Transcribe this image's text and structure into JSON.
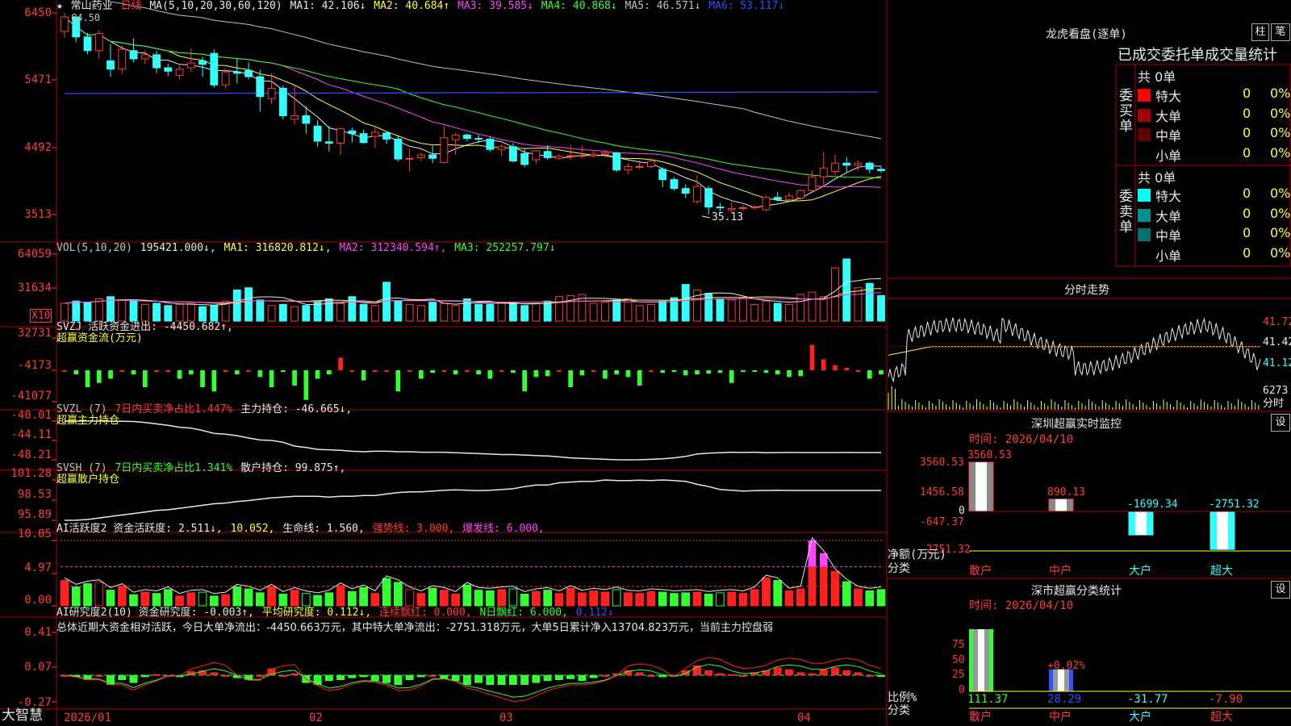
{
  "main": {
    "star": "★",
    "stock_name": "常山药业",
    "period": "日线",
    "ma_spec": "MA(5,10,20,30,60,120)",
    "ma": [
      {
        "label": "MA1:",
        "value": "42.106",
        "arrow": "↓",
        "color": "#e8e8e8"
      },
      {
        "label": "MA2:",
        "value": "40.684",
        "arrow": "↑",
        "color": "#ffff33"
      },
      {
        "label": "MA3:",
        "value": "39.585",
        "arrow": "↓",
        "color": "#ff44ff"
      },
      {
        "label": "MA4:",
        "value": "40.868",
        "arrow": "↓",
        "color": "#33ff33"
      },
      {
        "label": "MA5:",
        "value": "46.571",
        "arrow": "↓",
        "color": "#c0c0c0"
      },
      {
        "label": "MA6:",
        "value": "53.117",
        "arrow": "↓",
        "color": "#3050ff"
      }
    ],
    "y_labels": [
      "6450",
      "5471",
      "4492",
      "3513"
    ],
    "high_marker": "64.50",
    "low_marker": "35.13"
  },
  "vol": {
    "header": [
      {
        "t": "VOL(5,10,20)",
        "c": "#c0c0c0"
      },
      {
        "t": " 195421.000↓,",
        "c": "#e8e8e8"
      },
      {
        "t": " MA1: 316820.812↓,",
        "c": "#ffff33"
      },
      {
        "t": " MA2: 312340.594↑,",
        "c": "#ff44ff"
      },
      {
        "t": " MA3: 252257.797↓",
        "c": "#33ff33"
      }
    ],
    "y_labels": [
      "64059",
      "31634"
    ],
    "unit": "X10"
  },
  "svzj": {
    "header": [
      {
        "t": "SVZJ  活跃资金进出: -4450.682↑,",
        "c": "#e8e8e8"
      }
    ],
    "sub": "超赢资金流(万元)",
    "y_labels": [
      "32731",
      "-4173",
      "-41077"
    ]
  },
  "svzl": {
    "header": [
      {
        "t": "SVZL (7) ",
        "c": "#c0c0c0"
      },
      {
        "t": "7日内买卖净占比1.447%",
        "c": "#ff3b3b"
      },
      {
        "t": " 主力持仓: -46.665↓,",
        "c": "#e8e8e8"
      }
    ],
    "sub": "超赢主力持仓",
    "y_labels": [
      "-40.01",
      "-44.11",
      "-48.21"
    ]
  },
  "svsh": {
    "header": [
      {
        "t": "SVSH (7) ",
        "c": "#c0c0c0"
      },
      {
        "t": "7日内买卖净占比1.341%",
        "c": "#33ff33"
      },
      {
        "t": " 散户持仓: 99.875↑,",
        "c": "#e8e8e8"
      }
    ],
    "sub": "超赢散户持仓",
    "y_labels": [
      "101.28",
      "98.53",
      "95.89"
    ]
  },
  "ai1": {
    "header": [
      {
        "t": "AI活跃度2 资金活跃度: 2.511↓,",
        "c": "#e8e8e8"
      },
      {
        "t": " 10.052,",
        "c": "#ffff33"
      },
      {
        "t": " 生命线: 1.560,",
        "c": "#e8e8e8"
      },
      {
        "t": " 强势线: 3.000,",
        "c": "#ff3b3b"
      },
      {
        "t": " 爆发线: 6.000,",
        "c": "#ff44ff"
      }
    ],
    "y_labels": [
      "10.05",
      "4.97",
      "0.00"
    ]
  },
  "ai2": {
    "header": [
      {
        "t": "AI研究度2(10) 资金研究度: -0.003↑,",
        "c": "#e8e8e8"
      },
      {
        "t": " 平均研究度: 0.112↓,",
        "c": "#ffff33"
      },
      {
        "t": " 连续飘红: 0.000,",
        "c": "#ff3b3b"
      },
      {
        "t": " N日飘红: 6.000,",
        "c": "#33ff33"
      },
      {
        "t": " 0.112↓",
        "c": "#3050ff"
      }
    ],
    "summary": "总体近期大资金相对活跃，今日大单净流出：-4450.663万元，其中特大单净流出：-2751.318万元，大单5日累计净入13704.823万元，当前主力控盘弱",
    "y_labels": [
      "0.41",
      "0.07",
      "-0.27"
    ]
  },
  "xaxis": {
    "brand": "大智慧",
    "dates": [
      "2026/01",
      "02",
      "03",
      "04"
    ]
  },
  "right": {
    "tiger_title": "龙虎看盘(逐单)",
    "btn_bar": "柱",
    "btn_pen": "笔",
    "tabs_text": "已成交委托单成交量统计",
    "buy_group_label": "委买单",
    "sell_group_label": "委卖单",
    "buy_total": "共 0单",
    "sell_total": "共 0单",
    "buy_rows": [
      {
        "name": "特大",
        "count": "0",
        "pct": "0%",
        "color": "#ff0000"
      },
      {
        "name": "大单",
        "count": "0",
        "pct": "0%",
        "color": "#a00000"
      },
      {
        "name": "中单",
        "count": "0",
        "pct": "0%",
        "color": "#600000"
      },
      {
        "name": "小单",
        "count": "0",
        "pct": "0%",
        "color": "#000000"
      }
    ],
    "sell_rows": [
      {
        "name": "特大",
        "count": "0",
        "pct": "0%",
        "color": "#00ffff"
      },
      {
        "name": "大单",
        "count": "0",
        "pct": "0%",
        "color": "#009090"
      },
      {
        "name": "中单",
        "count": "0",
        "pct": "0%",
        "color": "#007070"
      },
      {
        "name": "小单",
        "count": "0",
        "pct": "0%",
        "color": "#000000"
      }
    ],
    "intraday_title": "分时走势",
    "intraday_prices": [
      "41.72",
      "41.42",
      "41.12"
    ],
    "intraday_vol": "6273",
    "intraday_vol_unit": "分时",
    "monitor_title": "深圳超赢实时监控",
    "monitor_btn": "设",
    "monitor_time": "时间: 2026/04/10",
    "monitor_axis": [
      "3560.53",
      "1456.58",
      "0",
      "-647.37",
      "-2751.32"
    ],
    "monitor_unit": "净额(万元)",
    "monitor_cat_label": "分类",
    "monitor_bars": [
      {
        "name": "散户",
        "value": 3560.53,
        "label": "3560.53",
        "name_color": "#ff3b3b"
      },
      {
        "name": "中户",
        "value": 890.13,
        "label": "890.13",
        "name_color": "#ff3b3b"
      },
      {
        "name": "大户",
        "value": -1699.34,
        "label": "-1699.34",
        "name_color": "#33ffff"
      },
      {
        "name": "超大",
        "value": -2751.32,
        "label": "-2751.32",
        "name_color": "#33ffff"
      }
    ],
    "class_title": "深市超赢分类统计",
    "class_btn": "设",
    "class_time": "时间: 2026/04/10",
    "class_axis": [
      "75",
      "50",
      "25",
      "0"
    ],
    "class_unit": "比例%",
    "class_cat_label": "分类",
    "class_bars": [
      {
        "name": "散户",
        "value": 111.37,
        "label": "111.37",
        "name_color": "#ff3b3b",
        "top_label": ""
      },
      {
        "name": "中户",
        "value": 28.29,
        "label": "28.29",
        "name_color": "#ff3b3b",
        "top_label": "+0.02%"
      },
      {
        "name": "大户",
        "value": -31.77,
        "label": "-31.77",
        "name_color": "#33ffff",
        "top_label": ""
      },
      {
        "name": "超大",
        "value": -7.9,
        "label": "-7.90",
        "name_color": "#ff3b3b",
        "top_label": ""
      }
    ]
  },
  "chart_data": {
    "type": "candlestick",
    "dates": [
      "2026/01",
      "02",
      "03",
      "04"
    ],
    "ohlc": [
      [
        61.8,
        64.5,
        60.9,
        63.9
      ],
      [
        63.9,
        64.3,
        60.2,
        61.0
      ],
      [
        61.0,
        61.6,
        58.5,
        59.0
      ],
      [
        59.0,
        62.0,
        57.8,
        61.5
      ],
      [
        57.5,
        60.0,
        55.2,
        56.3
      ],
      [
        56.3,
        59.8,
        55.6,
        59.2
      ],
      [
        59.0,
        60.8,
        57.3,
        57.8
      ],
      [
        57.8,
        59.1,
        57.0,
        58.4
      ],
      [
        58.4,
        59.0,
        55.7,
        56.5
      ],
      [
        56.5,
        57.1,
        55.3,
        56.0
      ],
      [
        55.4,
        56.8,
        54.8,
        56.3
      ],
      [
        56.5,
        59.3,
        55.9,
        57.2
      ],
      [
        57.5,
        58.1,
        55.2,
        57.0
      ],
      [
        58.6,
        59.2,
        53.6,
        54.0
      ],
      [
        54.0,
        56.4,
        53.5,
        55.9
      ],
      [
        55.9,
        57.8,
        54.2,
        55.7
      ],
      [
        56.1,
        57.3,
        54.8,
        55.2
      ],
      [
        55.2,
        56.2,
        50.1,
        52.3
      ],
      [
        52.0,
        55.7,
        51.2,
        53.5
      ],
      [
        53.5,
        53.9,
        49.0,
        49.5
      ],
      [
        49.0,
        54.0,
        48.2,
        49.5
      ],
      [
        49.5,
        50.9,
        46.9,
        48.4
      ],
      [
        48.0,
        48.9,
        45.0,
        45.8
      ],
      [
        45.7,
        48.0,
        44.3,
        45.5
      ],
      [
        45.5,
        47.8,
        43.8,
        47.6
      ],
      [
        47.3,
        47.8,
        45.6,
        46.9
      ],
      [
        46.9,
        47.5,
        45.4,
        45.6
      ],
      [
        46.5,
        48.1,
        44.8,
        47.1
      ],
      [
        47.0,
        47.2,
        45.4,
        46.1
      ],
      [
        46.1,
        46.7,
        42.8,
        43.2
      ],
      [
        43.2,
        44.8,
        41.4,
        43.3
      ],
      [
        43.4,
        44.1,
        42.9,
        43.8
      ],
      [
        43.8,
        45.1,
        42.6,
        43.3
      ],
      [
        42.7,
        48.0,
        42.5,
        46.3
      ],
      [
        46.0,
        47.0,
        43.8,
        46.7
      ],
      [
        46.7,
        46.9,
        45.8,
        46.2
      ],
      [
        46.2,
        46.8,
        45.5,
        46.1
      ],
      [
        46.1,
        46.5,
        44.3,
        44.6
      ],
      [
        44.6,
        45.4,
        43.6,
        45.0
      ],
      [
        45.0,
        45.5,
        42.7,
        42.9
      ],
      [
        44.0,
        44.7,
        42.0,
        42.4
      ],
      [
        43.1,
        44.5,
        42.5,
        44.4
      ],
      [
        44.3,
        45.2,
        43.1,
        43.4
      ],
      [
        43.3,
        44.0,
        43.1,
        43.6
      ],
      [
        43.6,
        45.3,
        43.0,
        43.7
      ],
      [
        43.7,
        45.1,
        43.3,
        43.7
      ],
      [
        43.7,
        44.5,
        43.5,
        43.9
      ],
      [
        43.9,
        44.5,
        43.4,
        44.1
      ],
      [
        44.1,
        44.3,
        41.3,
        41.6
      ],
      [
        41.6,
        42.6,
        41.0,
        42.1
      ],
      [
        42.1,
        43.0,
        41.7,
        42.1
      ],
      [
        42.1,
        43.3,
        41.8,
        42.9
      ],
      [
        41.7,
        42.0,
        39.1,
        40.2
      ],
      [
        40.2,
        40.6,
        38.6,
        38.9
      ],
      [
        38.9,
        39.5,
        37.5,
        38.2
      ],
      [
        37.0,
        40.8,
        36.7,
        39.2
      ],
      [
        38.9,
        39.3,
        35.1,
        36.2
      ],
      [
        36.2,
        36.8,
        35.5,
        36.1
      ],
      [
        35.8,
        36.9,
        35.2,
        36.0
      ],
      [
        36.0,
        36.5,
        35.6,
        36.1
      ],
      [
        36.1,
        36.5,
        35.9,
        36.2
      ],
      [
        35.8,
        37.9,
        35.6,
        37.6
      ],
      [
        37.6,
        38.4,
        37.0,
        37.3
      ],
      [
        37.3,
        38.3,
        37.1,
        37.8
      ],
      [
        37.5,
        38.8,
        37.2,
        38.6
      ],
      [
        38.6,
        41.5,
        38.2,
        40.6
      ],
      [
        40.6,
        44.2,
        39.1,
        41.9
      ],
      [
        41.4,
        43.8,
        40.8,
        42.6
      ],
      [
        42.6,
        43.5,
        41.3,
        42.3
      ],
      [
        42.3,
        43.0,
        41.5,
        42.6
      ],
      [
        42.6,
        42.8,
        41.1,
        41.7
      ],
      [
        41.7,
        42.1,
        41.2,
        41.5
      ]
    ],
    "volume_x10": [
      16,
      18,
      17,
      20,
      22,
      19,
      18,
      15,
      16,
      14,
      15,
      16,
      13,
      14,
      18,
      28,
      30,
      19,
      14,
      15,
      13,
      14,
      18,
      20,
      16,
      22,
      15,
      14,
      35,
      18,
      15,
      14,
      17,
      16,
      14,
      20,
      15,
      15,
      17,
      16,
      14,
      16,
      18,
      22,
      23,
      24,
      16,
      17,
      19,
      20,
      14,
      15,
      18,
      21,
      33,
      28,
      25,
      20,
      19,
      21,
      15,
      18,
      16,
      15,
      24,
      26,
      22,
      48,
      56,
      30,
      34,
      23
    ],
    "hot_fund_flow": [
      0,
      -5,
      -20,
      -15,
      -10,
      0,
      -5,
      -20,
      0,
      0,
      -10,
      -5,
      -20,
      -25,
      0,
      -5,
      0,
      -8,
      -20,
      -2,
      -18,
      -35,
      -10,
      -5,
      15,
      0,
      -12,
      0,
      0,
      -25,
      0,
      -10,
      -3,
      0,
      -5,
      0,
      -5,
      -10,
      0,
      -3,
      -25,
      -8,
      -7,
      0,
      -20,
      -6,
      0,
      -10,
      -5,
      -8,
      -18,
      0,
      -3,
      -2,
      -6,
      -5,
      -4,
      -3,
      -15,
      -2,
      -1,
      -3,
      -5,
      -8,
      -7,
      30,
      13,
      6,
      3,
      0,
      -10,
      -5
    ],
    "main_position": [
      -40.01,
      -40.02,
      -40.0,
      -40.01,
      -40.02,
      -40.05,
      -40.1,
      -40.3,
      -40.6,
      -40.9,
      -41.3,
      -41.5,
      -42.0,
      -42.6,
      -42.8,
      -43.1,
      -43.6,
      -44.0,
      -44.11,
      -44.5,
      -45.3,
      -45.6,
      -46.0,
      -46.1,
      -46.2,
      -46.4,
      -46.5,
      -46.4,
      -46.4,
      -46.5,
      -46.5,
      -46.6,
      -46.6,
      -46.6,
      -46.7,
      -46.8,
      -46.9,
      -47.0,
      -47.1,
      -47.1,
      -47.2,
      -47.3,
      -47.4,
      -47.6,
      -47.8,
      -47.9,
      -48.0,
      -48.1,
      -48.2,
      -48.21,
      -48.2,
      -48.1,
      -48.0,
      -47.8,
      -47.5,
      -47.0,
      -46.8,
      -46.7,
      -46.6,
      -46.65,
      -46.6,
      -46.7,
      -46.67,
      -46.66,
      -46.665,
      -46.67,
      -46.665,
      -46.67,
      -46.66,
      -46.665,
      -46.665,
      -46.665
    ],
    "retail_position": [
      95.89,
      95.9,
      96.0,
      96.2,
      96.4,
      96.6,
      96.8,
      97.0,
      97.2,
      97.3,
      97.5,
      97.7,
      97.9,
      98.1,
      98.2,
      98.4,
      98.53,
      98.7,
      98.9,
      99.0,
      99.1,
      99.1,
      99.1,
      99.0,
      99.1,
      99.1,
      99.2,
      99.2,
      99.4,
      99.6,
      99.7,
      99.7,
      99.8,
      99.9,
      99.95,
      99.9,
      99.85,
      99.9,
      100.0,
      100.1,
      100.4,
      100.6,
      100.6,
      100.9,
      101.0,
      101.1,
      101.1,
      101.28,
      101.2,
      101.2,
      101.25,
      101.2,
      101.28,
      101.2,
      101.1,
      100.7,
      100.4,
      100.0,
      99.9,
      99.8,
      99.85,
      99.875,
      99.9,
      99.875,
      99.875,
      99.875,
      99.875,
      99.875,
      99.875,
      99.875,
      99.875,
      99.875
    ],
    "ai_activity": [
      3.9,
      2.9,
      3.4,
      3.6,
      2.4,
      3.0,
      1.7,
      2.1,
      1.9,
      2.5,
      1.5,
      2.0,
      2.1,
      1.5,
      1.7,
      2.9,
      2.6,
      2.0,
      2.9,
      1.8,
      2.4,
      1.9,
      1.6,
      2.0,
      3.1,
      2.2,
      2.8,
      1.9,
      4.2,
      3.6,
      2.5,
      1.9,
      2.7,
      2.4,
      1.8,
      3.2,
      2.4,
      2.3,
      2.5,
      2.6,
      1.8,
      2.2,
      2.4,
      1.9,
      2.7,
      2.0,
      2.3,
      2.1,
      2.5,
      2.0,
      1.9,
      2.2,
      2.1,
      1.9,
      2.0,
      2.1,
      1.8,
      2.0,
      2.1,
      1.9,
      2.5,
      4.3,
      3.9,
      2.3,
      2.6,
      10.05,
      8.1,
      5.3,
      3.7,
      2.6,
      2.3,
      2.5
    ],
    "ai_research": [
      0.0,
      -0.02,
      -0.05,
      0.0,
      -0.1,
      -0.05,
      -0.08,
      -0.02,
      0.01,
      0.0,
      -0.02,
      0.04,
      0.05,
      0.03,
      0.0,
      -0.03,
      -0.05,
      0.0,
      0.07,
      0.0,
      0.02,
      -0.08,
      -0.1,
      -0.06,
      -0.05,
      -0.03,
      -0.02,
      -0.06,
      -0.08,
      -0.1,
      -0.05,
      -0.02,
      0.0,
      -0.04,
      -0.06,
      -0.1,
      -0.08,
      -0.12,
      -0.15,
      -0.14,
      -0.1,
      -0.08,
      -0.06,
      -0.05,
      -0.04,
      -0.06,
      -0.03,
      0.0,
      0.02,
      0.05,
      0.03,
      0.0,
      -0.02,
      0.0,
      0.05,
      0.1,
      0.05,
      0.02,
      0.01,
      0.0,
      0.03,
      0.05,
      0.08,
      0.06,
      0.03,
      0.02,
      0.06,
      0.08,
      0.05,
      0.03,
      0.0,
      -0.003
    ]
  }
}
